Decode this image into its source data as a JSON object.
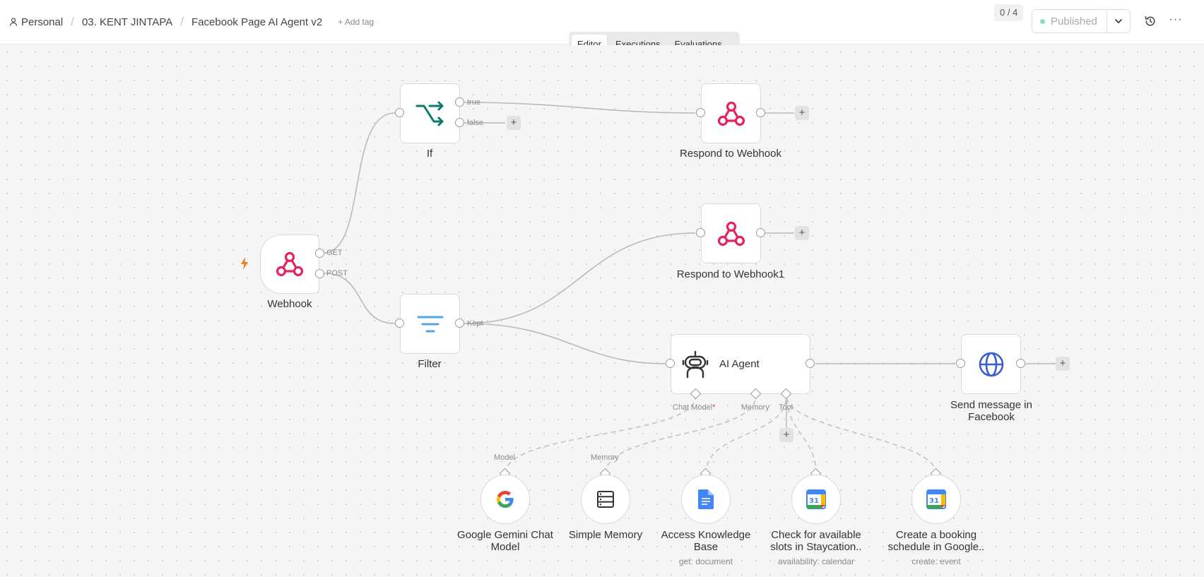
{
  "breadcrumb": {
    "owner": "Personal",
    "folder": "03. KENT JINTAPA",
    "workflow": "Facebook Page AI Agent v2",
    "add_tag": "+ Add tag"
  },
  "header": {
    "counter": "0 / 4",
    "publish_label": "Published"
  },
  "tabs": [
    "Editor",
    "Executions",
    "Evaluations"
  ],
  "active_tab": "Editor",
  "nodes": {
    "webhook": {
      "label": "Webhook",
      "out_get": "GET",
      "out_post": "POST"
    },
    "if": {
      "label": "If",
      "out_true": "true",
      "out_false": "false"
    },
    "filter": {
      "label": "Filter",
      "out_kept": "Kept"
    },
    "respond1": {
      "label": "Respond to Webhook"
    },
    "respond2": {
      "label": "Respond to Webhook1"
    },
    "agent": {
      "label": "AI Agent",
      "in_model": "Chat Model",
      "in_model_req": "*",
      "in_memory": "Memory",
      "in_tool": "Tool"
    },
    "send": {
      "label_line1": "Send message in",
      "label_line2": "Facebook"
    },
    "gemini": {
      "label_line1": "Google Gemini Chat",
      "label_line2": "Model",
      "port": "Model"
    },
    "memory": {
      "label": "Simple Memory",
      "port": "Memory"
    },
    "kb": {
      "label_line1": "Access Knowledge",
      "label_line2": "Base",
      "sub": "get: document"
    },
    "check": {
      "label_line1": "Check for available",
      "label_line2": "slots in Staycation..",
      "sub": "availability: calendar"
    },
    "booking": {
      "label_line1": "Create a booking",
      "label_line2": "schedule in Google..",
      "sub": "create: event"
    }
  },
  "icons": {
    "person": "person-icon",
    "webhook": "webhook-icon",
    "if": "branch-icon",
    "filter": "filter-icon",
    "agent": "robot-icon",
    "send": "globe-icon",
    "gemini": "google-icon",
    "memory": "database-icon",
    "kb": "google-docs-icon",
    "calendar": "google-calendar-icon",
    "history": "history-icon",
    "more": "more-icon",
    "chevron": "chevron-down-icon",
    "trigger": "lightning-icon"
  },
  "colors": {
    "webhook": "#e5245e",
    "if": "#0b7a6c",
    "filter": "#4fa6e8",
    "globe": "#3b5bdb",
    "published_dot": "#8fd9b6",
    "trigger_bolt": "#f07d1a"
  }
}
